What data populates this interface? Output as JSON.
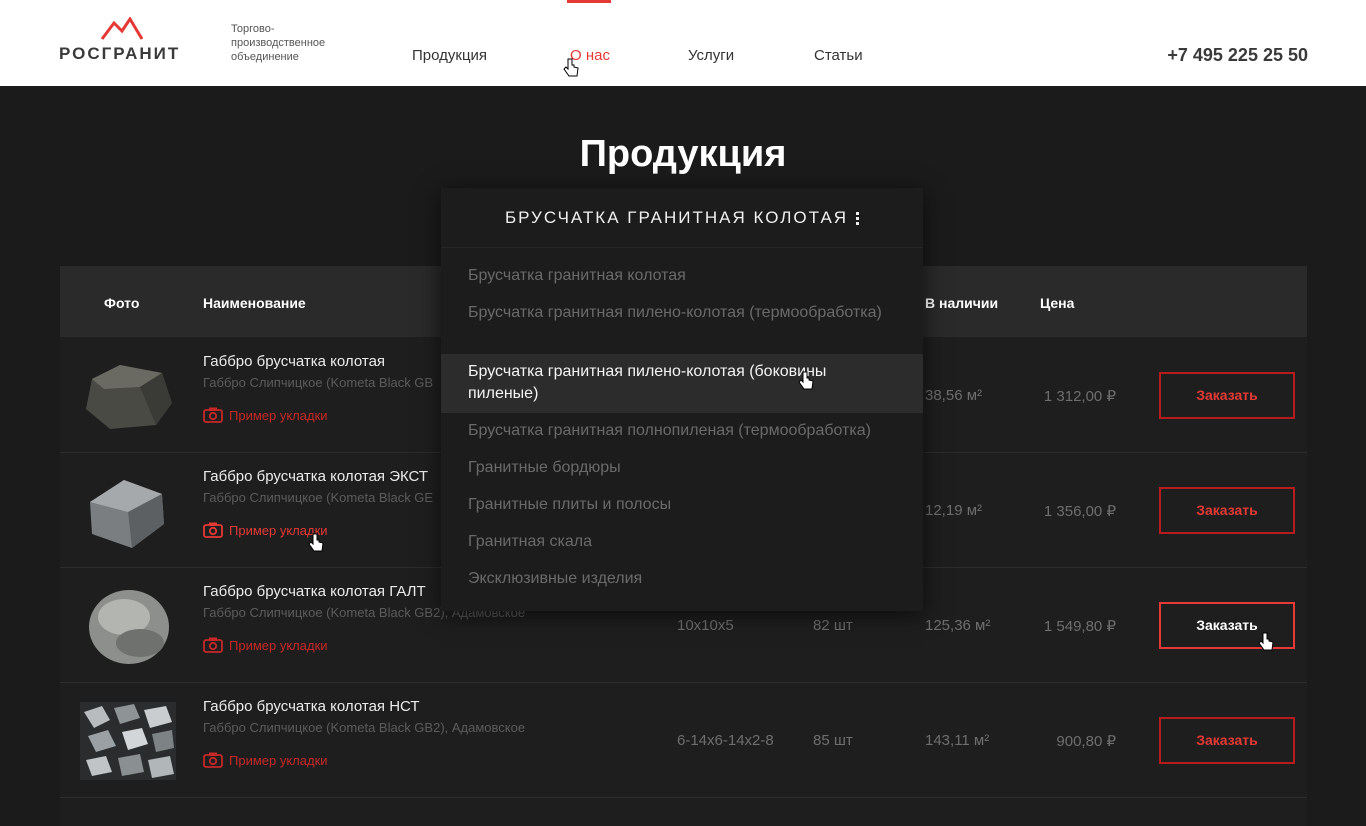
{
  "header": {
    "logo_text": "РОСГРАНИТ",
    "tagline": "Торгово-производственное объединение",
    "nav": [
      "Продукция",
      "О нас",
      "Услуги",
      "Статьи"
    ],
    "phone": "+7 495 225 25 50"
  },
  "page_title": "Продукция",
  "table": {
    "headers": [
      "Фото",
      "Наименование",
      "В наличии",
      "Цена"
    ],
    "order_label": "Заказать",
    "example_label": "Пример укладки",
    "rows": [
      {
        "name": "Габбро брусчатка колотая",
        "sub": "Габбро Слипчицкое (Kometa Black GB",
        "size": "",
        "count": "",
        "stock": "38,56 м²",
        "price": "1 312,00 ₽"
      },
      {
        "name": "Габбро брусчатка колотая ЭКСТ",
        "sub": "Габбро Слипчицкое (Kometa Black GE",
        "size": "",
        "count": "",
        "stock": "12,19 м²",
        "price": "1 356,00 ₽"
      },
      {
        "name": "Габбро брусчатка колотая ГАЛТ",
        "sub": "Габбро Слипчицкое (Kometa Black GB2), Адамовское",
        "size": "10х10х5",
        "count": "82 шт",
        "stock": "125,36 м²",
        "price": "1 549,80 ₽"
      },
      {
        "name": "Габбро брусчатка колотая НСТ",
        "sub": "Габбро Слипчицкое (Kometa Black GB2), Адамовское",
        "size": "6-14х6-14х2-8",
        "count": "85 шт",
        "stock": "143,11 м²",
        "price": "900,80 ₽"
      }
    ]
  },
  "dropdown": {
    "title": "БРУСЧАТКА ГРАНИТНАЯ КОЛОТАЯ",
    "items": [
      "Брусчатка гранитная колотая",
      "Брусчатка гранитная пилено-колотая (термообработка)",
      "Брусчатка гранитная пилено-колотая (боковины пиленые)",
      "Брусчатка гранитная полнопиленая (термообработка)",
      "Гранитные бордюры",
      "Гранитные плиты и полосы",
      "Гранитная скала",
      "Эксклюзивные изделия"
    ],
    "highlighted_index": 2
  },
  "colors": {
    "accent": "#e53935",
    "background": "#1b1b1b",
    "header_bg": "#ffffff"
  }
}
